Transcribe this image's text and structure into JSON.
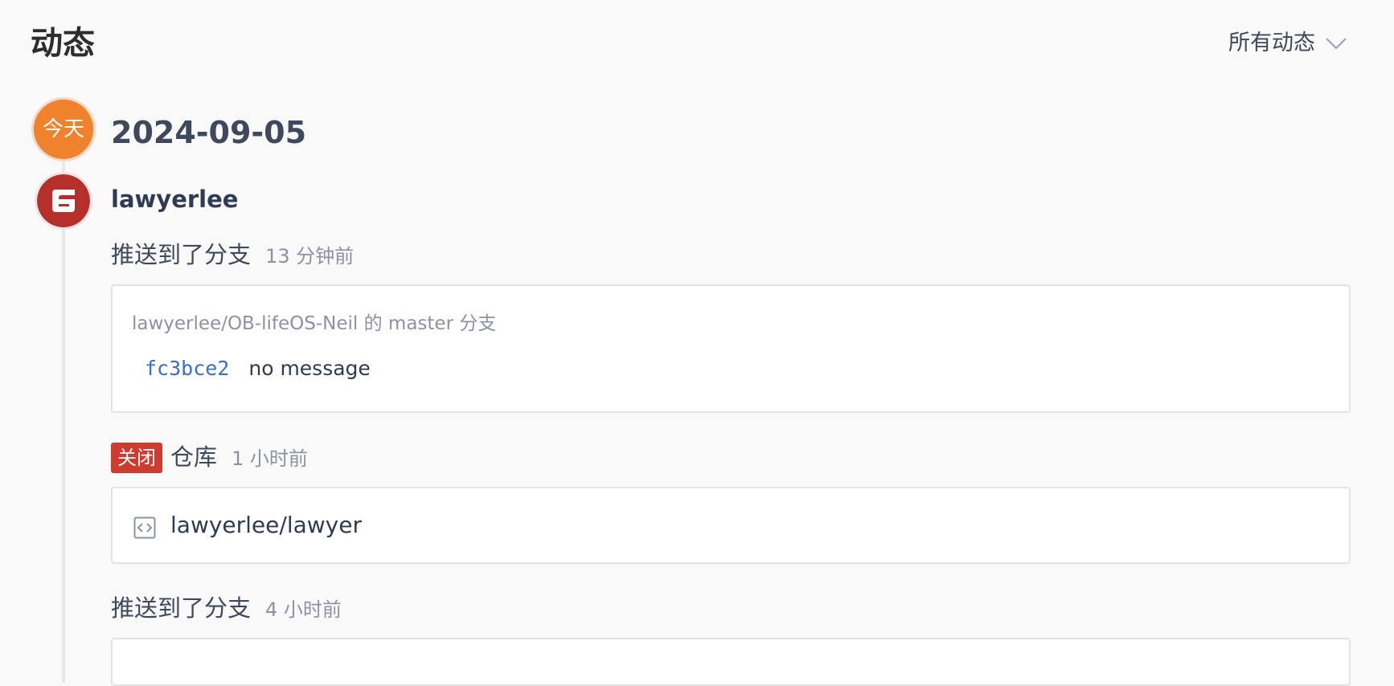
{
  "header": {
    "title": "动态",
    "filter_label": "所有动态"
  },
  "timeline": {
    "today_label": "今天",
    "date": "2024-09-05",
    "username": "lawyerlee",
    "events": [
      {
        "action": "推送到了分支",
        "time": "13 分钟前",
        "branch_info": "lawyerlee/OB-lifeOS-Neil 的 master 分支",
        "commit_hash": "fc3bce2",
        "commit_message": "no message"
      },
      {
        "tag": "关闭",
        "action": "仓库",
        "time": "1 小时前",
        "repo": "lawyerlee/lawyer"
      },
      {
        "action": "推送到了分支",
        "time": "4 小时前"
      }
    ]
  },
  "colors": {
    "today_badge": "#f0812d",
    "avatar_bg": "#b5302a",
    "closed_tag": "#cd3c2f",
    "commit_hash": "#3c6ec1"
  }
}
